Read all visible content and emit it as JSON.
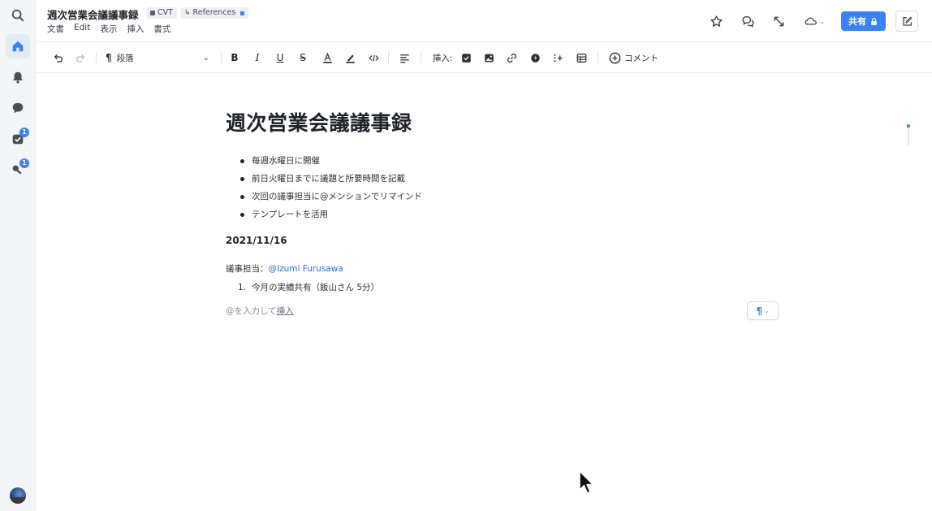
{
  "document": {
    "title": "週次営業会議議事録",
    "tags": [
      {
        "label": "CVT"
      },
      {
        "label": "References"
      }
    ]
  },
  "menu": [
    "文書",
    "Edit",
    "表示",
    "挿入",
    "書式"
  ],
  "header": {
    "share_label": "共有"
  },
  "toolbar": {
    "style_label": "段落",
    "insert_label": "挿入:",
    "comment_label": "コメント"
  },
  "content": {
    "heading": "週次営業会議議事録",
    "bullets": [
      "毎週水曜日に開催",
      "前日火曜日までに議題と所要時間を記載",
      "次回の議事担当に@メンションでリマインド",
      "テンプレートを活用"
    ],
    "date": "2021/11/16",
    "owner_label": "議事担当：",
    "owner_mention": "@Izumi Furusawa",
    "numbered": [
      {
        "num": "1.",
        "text": "今月の実績共有（飯山さん 5分）"
      }
    ],
    "placeholder_text": "@を入力して",
    "placeholder_link": "挿入",
    "para_symbol": "¶"
  },
  "sidebar": {
    "badges": {
      "tasks": "1",
      "keys": "1"
    }
  },
  "colors": {
    "accent": "#3b82f6",
    "mention": "#2f6fd8"
  }
}
